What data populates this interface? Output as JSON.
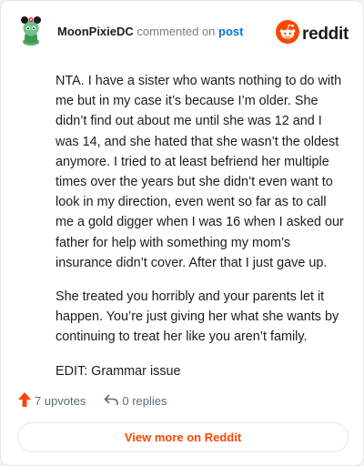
{
  "header": {
    "username": "MoonPixieDC",
    "verb": "commented on",
    "post_link": "post",
    "brand": "reddit"
  },
  "comment": {
    "paragraphs": [
      "NTA. I have a sister who wants nothing to do with me but in my case it’s because I’m older. She didn’t find out about me until she was 12 and I was 14, and she hated that she wasn’t the oldest anymore. I tried to at least befriend her multiple times over the years but she didn’t even want to look in my direction, even went so far as to call me a gold digger when I was 16 when I asked our father for help with something my mom’s insurance didn’t cover. After that I just gave up.",
      "She treated you horribly and your parents let it happen. You’re just giving her what she wants by continuing to treat her like you aren’t family.",
      "EDIT: Grammar issue"
    ]
  },
  "footer": {
    "upvotes": "7 upvotes",
    "replies": "0 replies",
    "view_more": "View more on Reddit"
  },
  "colors": {
    "accent": "#ff4500",
    "link": "#0079d3",
    "muted": "#576f76"
  },
  "icons": [
    "user-avatar",
    "reddit-logo-icon",
    "upvote-arrow-icon",
    "reply-arrow-icon"
  ]
}
